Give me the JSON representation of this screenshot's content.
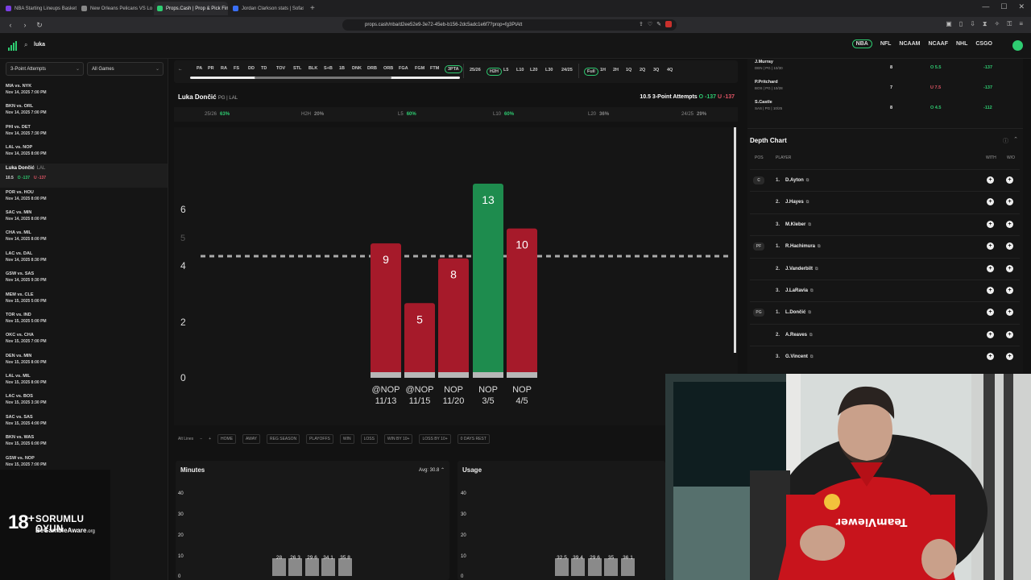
{
  "browser": {
    "tabs": [
      {
        "label": "NBA Starting Lineups Basketball Da",
        "color": "#7b3fe4",
        "active": false
      },
      {
        "label": "New Orleans Pelicans VS Los Angeles",
        "color": "#888888",
        "active": false
      },
      {
        "label": "Props.Cash | Prop & Pick Finder",
        "color": "#2ecc71",
        "active": true
      },
      {
        "label": "Jordan Clarkson stats | Sofascore",
        "color": "#3a6ff7",
        "active": false
      }
    ],
    "new_tab": "+",
    "url": "props.cash/nba/d2ee52e9-3e72-45eb-b156-2dc5adc1e6f7?prop=fg3PtAtt"
  },
  "header": {
    "search_text": "luka",
    "leagues": [
      "NBA",
      "NFL",
      "NCAAM",
      "NCAAF",
      "NHL",
      "CSGO"
    ],
    "selected_league": "NBA"
  },
  "sidebar": {
    "stat_select": "3-Point Attempts",
    "games_select": "All Games",
    "games": [
      {
        "title": "MIA vs. NYK",
        "date": "Nov 14, 2025 7:00 PM"
      },
      {
        "title": "BKN vs. ORL",
        "date": "Nov 14, 2025 7:00 PM"
      },
      {
        "title": "PHI vs. DET",
        "date": "Nov 14, 2025 7:30 PM"
      },
      {
        "title": "LAL vs. NOP",
        "date": "Nov 14, 2025 8:00 PM"
      }
    ],
    "selected_player": {
      "name": "Luka Dončić",
      "team": "LAL",
      "line": "10.5",
      "over": "O -137",
      "under": "U -137"
    },
    "games_after": [
      {
        "title": "POR vs. HOU",
        "date": "Nov 14, 2025 8:00 PM"
      },
      {
        "title": "SAC vs. MIN",
        "date": "Nov 14, 2025 8:00 PM"
      },
      {
        "title": "CHA vs. MIL",
        "date": "Nov 14, 2025 8:00 PM"
      },
      {
        "title": "LAC vs. DAL",
        "date": "Nov 14, 2025 8:30 PM"
      },
      {
        "title": "GSW vs. SAS",
        "date": "Nov 14, 2025 9:30 PM"
      },
      {
        "title": "MEM vs. CLE",
        "date": "Nov 15, 2025 5:00 PM"
      },
      {
        "title": "TOR vs. IND",
        "date": "Nov 15, 2025 5:00 PM"
      },
      {
        "title": "OKC vs. CHA",
        "date": "Nov 15, 2025 7:00 PM"
      },
      {
        "title": "DEN vs. MIN",
        "date": "Nov 15, 2025 8:00 PM"
      },
      {
        "title": "LAL vs. MIL",
        "date": "Nov 15, 2025 8:00 PM"
      },
      {
        "title": "LAC vs. BOS",
        "date": "Nov 15, 2025 3:30 PM"
      },
      {
        "title": "SAC vs. SAS",
        "date": "Nov 15, 2025 4:00 PM"
      },
      {
        "title": "BKN vs. WAS",
        "date": "Nov 15, 2025 6:00 PM"
      },
      {
        "title": "GSW vs. NOP",
        "date": "Nov 15, 2025 7:00 PM"
      }
    ]
  },
  "gamble": {
    "age": "18",
    "plus": "+",
    "line1": "SORUMLU OYUN",
    "line2a": "BeGambleAware",
    "line2b": ".org"
  },
  "filters": {
    "stats": [
      "PA",
      "PR",
      "RA",
      "FS",
      "DD",
      "TD",
      "TOV",
      "STL",
      "BLK",
      "S+B",
      "1B",
      "DNK",
      "DRB",
      "ORB",
      "FGA",
      "FGM",
      "FTM",
      "3PTA"
    ],
    "selected_stat": "3PTA",
    "ranges": [
      "25/26",
      "H2H",
      "L5",
      "L10",
      "L20",
      "L30",
      "24/25"
    ],
    "selected_range": "H2H",
    "periods": [
      "Full",
      "1H",
      "2H",
      "1Q",
      "2Q",
      "3Q",
      "4Q"
    ],
    "selected_period": "Full"
  },
  "player": {
    "name": "Luka Dončić",
    "meta": "PG | LAL",
    "line_label": "10.5 3-Point Attempts",
    "over": "O -137",
    "under": "U -137"
  },
  "hitrates": [
    {
      "label": "25/26",
      "value": "63%",
      "hit": true
    },
    {
      "label": "H2H",
      "value": "20%",
      "hit": false
    },
    {
      "label": "L5",
      "value": "60%",
      "hit": true
    },
    {
      "label": "L10",
      "value": "60%",
      "hit": true
    },
    {
      "label": "L20",
      "value": "36%",
      "hit": false
    },
    {
      "label": "24/25",
      "value": "29%",
      "hit": false
    }
  ],
  "chart_data": {
    "type": "bar",
    "categories": [
      "@NOP 11/13",
      "@NOP 11/15",
      "NOP 11/20",
      "NOP 3/5",
      "NOP 4/5"
    ],
    "values": [
      9,
      5,
      8,
      13,
      10
    ],
    "line": 10.5,
    "yticks": [
      "0",
      "2",
      "4",
      "5",
      "6"
    ],
    "colors": {
      "over": "#1e8c4e",
      "under": "#a61a2a"
    }
  },
  "chart_footer": {
    "all_lines": "Alt Lines",
    "minus": "−",
    "plus": "+",
    "filters": [
      "HOME",
      "AWAY",
      "REG SEASON",
      "PLAYOFFS",
      "WIN",
      "LOSS",
      "WIN BY 10+",
      "LOSS BY 10+",
      "0 DAYS REST"
    ]
  },
  "minutes": {
    "title": "Minutes",
    "avg": "Avg: 30.8",
    "yticks": [
      "0",
      "10",
      "20",
      "30",
      "40"
    ],
    "values": [
      28,
      26.3,
      29.6,
      34.1,
      35.8
    ]
  },
  "usage": {
    "title": "Usage",
    "yticks": [
      "0",
      "10",
      "20",
      "30",
      "40"
    ],
    "values": [
      32.5,
      39.4,
      29.6,
      35,
      36.1
    ]
  },
  "props_table": [
    {
      "name": "J.Murray",
      "sub": "DEN | PG | 10/30",
      "gp": "8",
      "line": "O 5.5",
      "odds": "-137",
      "over": true
    },
    {
      "name": "P.Pritchard",
      "sub": "BOS | PG | 10/28",
      "gp": "7",
      "line": "U 7.5",
      "odds": "-137",
      "over": false
    },
    {
      "name": "S.Castle",
      "sub": "SAS | PG | 10/25",
      "gp": "8",
      "line": "O 4.5",
      "odds": "-112",
      "over": true
    }
  ],
  "depth_chart": {
    "title": "Depth Chart",
    "headers": {
      "pos": "POS",
      "player": "PLAYER",
      "with": "WITH",
      "without": "W/O"
    },
    "rows": [
      {
        "pos": "C",
        "num": "1.",
        "name": "D.Ayton"
      },
      {
        "pos": "",
        "num": "2.",
        "name": "J.Hayes"
      },
      {
        "pos": "",
        "num": "3.",
        "name": "M.Kleber"
      },
      {
        "pos": "PF",
        "num": "1.",
        "name": "R.Hachimura"
      },
      {
        "pos": "",
        "num": "2.",
        "name": "J.Vanderbilt"
      },
      {
        "pos": "",
        "num": "3.",
        "name": "J.LaRavia"
      },
      {
        "pos": "PG",
        "num": "1.",
        "name": "L.Dončić"
      },
      {
        "pos": "",
        "num": "2.",
        "name": "A.Reaves"
      },
      {
        "pos": "",
        "num": "3.",
        "name": "G.Vincent"
      }
    ]
  },
  "webcam": {
    "shirt_sponsor": "TeamViewer"
  }
}
